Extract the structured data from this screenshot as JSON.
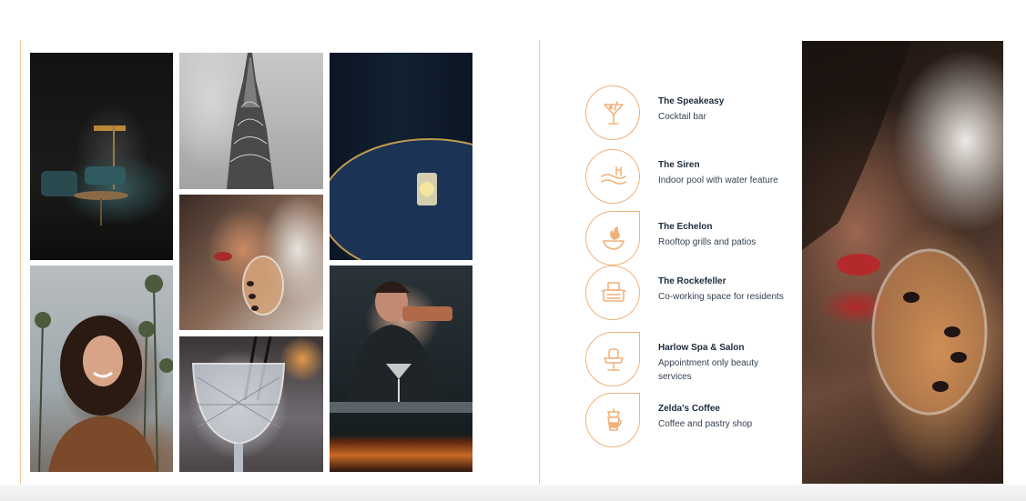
{
  "colors": {
    "accent": "#f1b27a",
    "title_text": "#1b2a3a",
    "desc_text": "#34414f"
  },
  "photos": [
    {
      "name": "lounge-photo"
    },
    {
      "name": "chrysler-building-photo"
    },
    {
      "name": "cocktail-table-photo"
    },
    {
      "name": "woman-drinking-photo"
    },
    {
      "name": "smiling-woman-photo"
    },
    {
      "name": "crystal-glass-photo"
    },
    {
      "name": "bartender-photo"
    },
    {
      "name": "woman-drinking-large-photo"
    }
  ],
  "amenities": [
    {
      "title": "The Speakeasy",
      "desc": "Cocktail bar",
      "icon": "cocktail-icon"
    },
    {
      "title": "The Siren",
      "desc": "Indoor pool with water feature",
      "icon": "pool-icon"
    },
    {
      "title": "The Echelon",
      "desc": "Rooftop grills and patios",
      "icon": "grill-fire-icon"
    },
    {
      "title": "The Rockefeller",
      "desc": "Co-working space for residents",
      "icon": "typewriter-icon"
    },
    {
      "title": "Harlow Spa & Salon",
      "desc": "Appointment only beauty services",
      "icon": "salon-chair-icon"
    },
    {
      "title": "Zelda's Coffee",
      "desc": "Coffee and pastry shop",
      "icon": "coffee-maker-icon"
    }
  ]
}
